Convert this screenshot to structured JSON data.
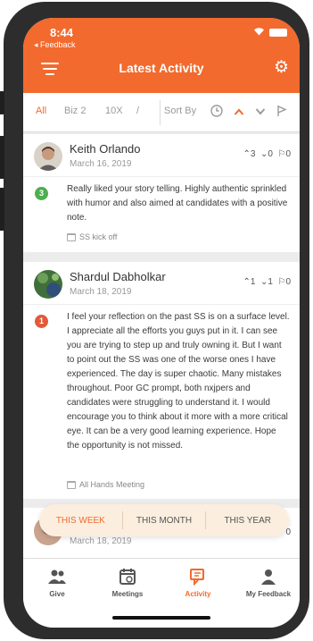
{
  "status_bar": {
    "time": "8:44",
    "back_label": "◂ Feedback"
  },
  "header": {
    "title": "Latest Activity",
    "menu_icon": "menu-icon",
    "settings_icon": "gear-icon"
  },
  "filters": {
    "tabs": [
      {
        "label": "All",
        "active": true
      },
      {
        "label": "Biz 2",
        "active": false
      },
      {
        "label": "10X",
        "active": false
      },
      {
        "label": "/",
        "active": false
      }
    ],
    "sort_label": "Sort By",
    "sort_controls": [
      "clock-icon",
      "chevron-up-icon",
      "chevron-down-icon",
      "flag-icon"
    ]
  },
  "posts": [
    {
      "author": "Keith Orlando",
      "date": "March 16, 2019",
      "upvotes": "3",
      "downvotes": "0",
      "flags": "0",
      "badge": "3",
      "badge_color": "#4caf50",
      "body": "Really liked your story telling. Highly authentic sprinkled with humor and also aimed at candidates with a positive note.",
      "tag": "SS kick off"
    },
    {
      "author": "Shardul Dabholkar",
      "date": "March 18, 2019",
      "upvotes": "1",
      "downvotes": "1",
      "flags": "0",
      "badge": "1",
      "badge_color": "#e05a3a",
      "body": "I feel your reflection on the past SS is on a surface level. I appreciate all the efforts you guys put in it. I can see you are trying to step up and truly owning it. But I want to point out the SS was one of the worse ones I have experienced. The day is super chaotic. Many mistakes throughout. Poor GC prompt, both nxjpers and candidates were struggling to understand it. I would encourage you to think about it more with a more critical eye. It can be a very good learning experience. Hope the opportunity is not missed.",
      "tag": "All Hands Meeting"
    },
    {
      "date": "March 18, 2019",
      "flags": "0"
    }
  ],
  "period_filter": {
    "items": [
      "THIS WEEK",
      "THIS MONTH",
      "THIS YEAR"
    ],
    "active": "THIS WEEK"
  },
  "tab_bar": {
    "items": [
      {
        "label": "Give",
        "icon": "people-icon"
      },
      {
        "label": "Meetings",
        "icon": "calendar-icon"
      },
      {
        "label": "Activity",
        "icon": "chat-icon"
      },
      {
        "label": "My Feedback",
        "icon": "person-icon"
      }
    ],
    "active": "Activity"
  },
  "colors": {
    "accent": "#f26a2e",
    "background": "#ececec",
    "phone_frame": "#2d2d2d"
  }
}
